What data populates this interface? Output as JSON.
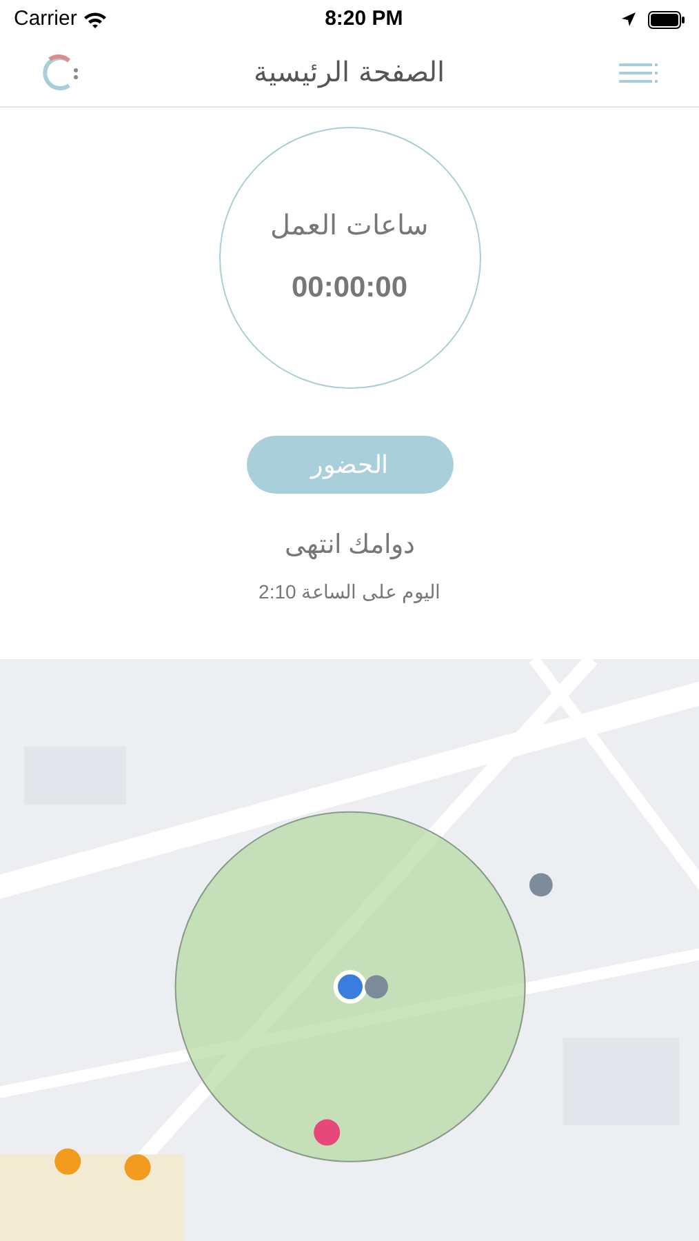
{
  "status_bar": {
    "carrier": "Carrier",
    "time": "8:20 PM"
  },
  "header": {
    "title": "الصفحة الرئيسية"
  },
  "timer": {
    "label": "ساعات العمل",
    "value": "00:00:00"
  },
  "attendance_button": {
    "label": "الحضور",
    "disabled": true
  },
  "shift_status": {
    "message": "دوامك انتهى",
    "detail": "اليوم على الساعة 2:10"
  }
}
